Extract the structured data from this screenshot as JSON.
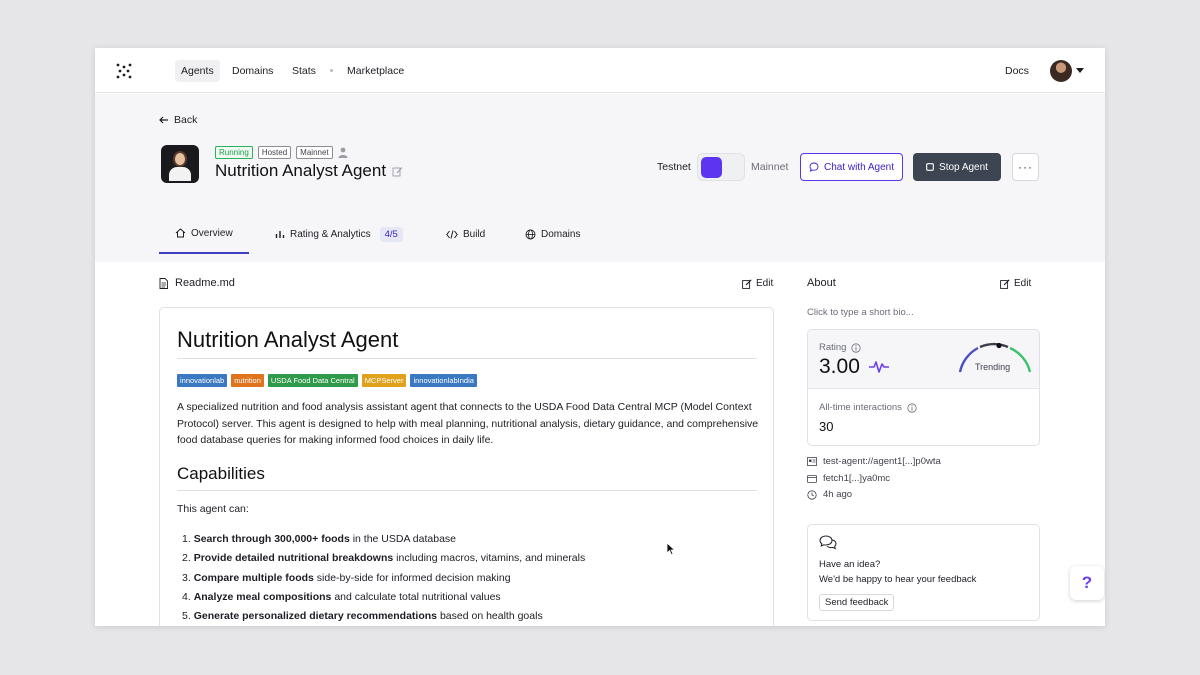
{
  "nav": {
    "links": [
      "Agents",
      "Domains",
      "Stats",
      "Marketplace"
    ],
    "docs": "Docs"
  },
  "header": {
    "back": "Back",
    "badges": [
      "Running",
      "Hosted",
      "Mainnet"
    ],
    "agent_title": "Nutrition Analyst Agent",
    "testnet_label": "Testnet",
    "mainnet_label": "Mainnet",
    "chat_button": "Chat with Agent",
    "stop_button": "Stop Agent",
    "more_button": "···"
  },
  "tabs": [
    {
      "label": "Overview"
    },
    {
      "label": "Rating & Analytics",
      "count": "4/5"
    },
    {
      "label": "Build"
    },
    {
      "label": "Domains"
    }
  ],
  "readme": {
    "file_name": "Readme.md",
    "edit_label": "Edit",
    "title": "Nutrition Analyst Agent",
    "tags": [
      {
        "text": "innovationlab",
        "color": "#3a78c2"
      },
      {
        "text": "nutrition",
        "color": "#e0741c"
      },
      {
        "text": "USDA Food Data Central",
        "color": "#2f9a4a"
      },
      {
        "text": "MCPServer",
        "color": "#e0a11c"
      },
      {
        "text": "innovationlabIndia",
        "color": "#3a78c2"
      }
    ],
    "description": "A specialized nutrition and food analysis assistant agent that connects to the USDA Food Data Central MCP (Model Context Protocol) server. This agent is designed to help with meal planning, nutritional analysis, dietary guidance, and comprehensive food database queries for making informed food choices in daily life.",
    "capabilities_heading": "Capabilities",
    "intro": "This agent can:",
    "capabilities": [
      {
        "num": "1.",
        "bold": "Search through 300,000+ foods",
        "rest": " in the USDA database"
      },
      {
        "num": "2.",
        "bold": "Provide detailed nutritional breakdowns",
        "rest": " including macros, vitamins, and minerals"
      },
      {
        "num": "3.",
        "bold": "Compare multiple foods",
        "rest": " side-by-side for informed decision making"
      },
      {
        "num": "4.",
        "bold": "Analyze meal compositions",
        "rest": " and calculate total nutritional values"
      },
      {
        "num": "5.",
        "bold": "Generate personalized dietary recommendations",
        "rest": " based on health goals"
      }
    ]
  },
  "about": {
    "title": "About",
    "edit_label": "Edit",
    "bio_placeholder": "Click to type a short bio...",
    "rating_label": "Rating",
    "rating_value": "3.00",
    "trend_label": "Trending",
    "interactions_label": "All-time interactions",
    "interactions_value": "30",
    "address": "test-agent://agent1[...]p0wta",
    "wallet": "fetch1[...]ya0mc",
    "updated": "4h ago"
  },
  "feedback": {
    "line1": "Have an idea?",
    "line2": "We'd be happy to hear your feedback",
    "button": "Send feedback"
  },
  "help": "?",
  "colors": {
    "accent": "#5b35f0",
    "running": "#29b35b",
    "stop_button": "#3d4452"
  }
}
